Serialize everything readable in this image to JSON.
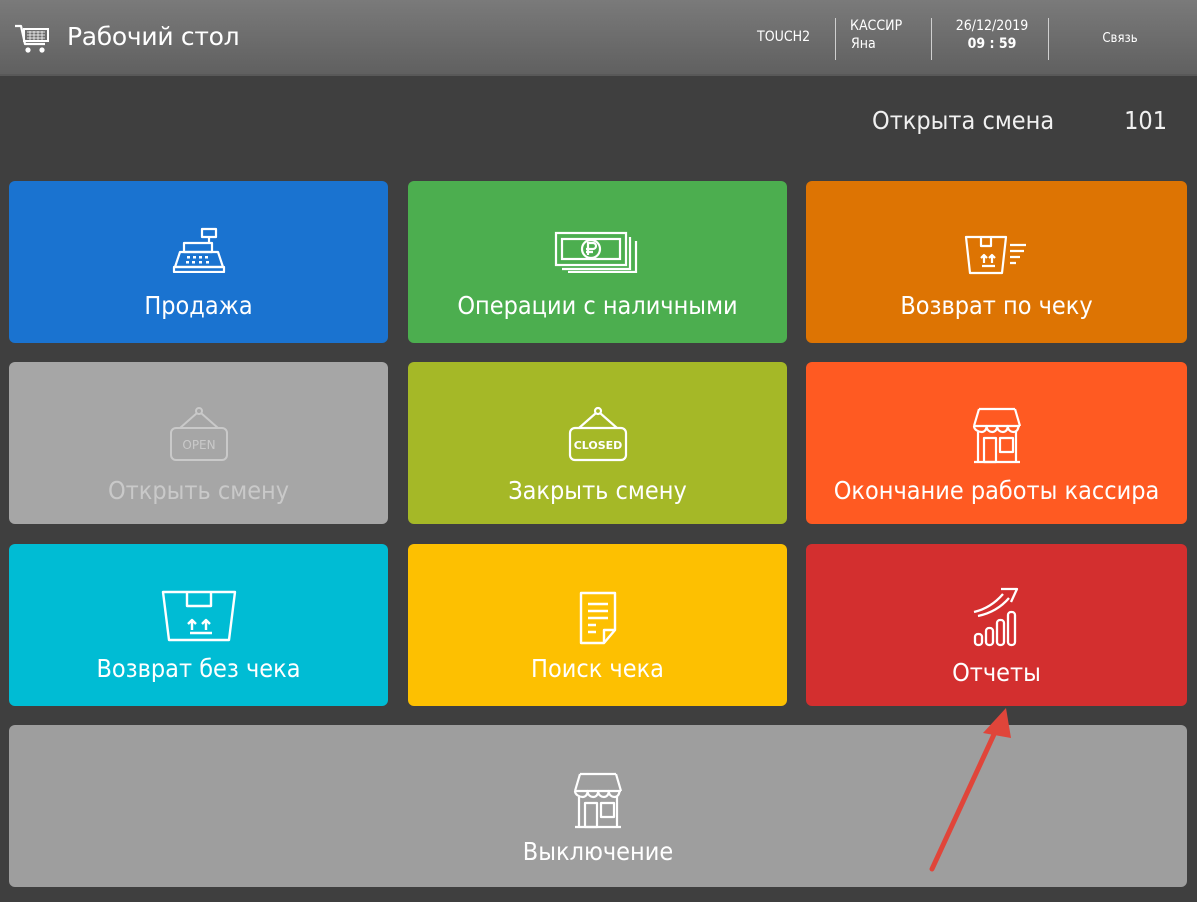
{
  "header": {
    "title": "Рабочий стол",
    "title_icon": "cart-icon",
    "terminal": "TOUCH2",
    "cashier_role": "КАССИР",
    "cashier_name": "Яна",
    "date": "26/12/2019",
    "time": "09 : 59",
    "connection_label": "Связь"
  },
  "shift": {
    "status_label": "Открыта смена",
    "number": "101"
  },
  "tiles": [
    {
      "label": "Продажа",
      "icon": "cash-register-icon",
      "color": "#1a73d0",
      "enabled": true
    },
    {
      "label": "Операции с наличными",
      "icon": "cash-ruble-icon",
      "color": "#4cae4f",
      "enabled": true
    },
    {
      "label": "Возврат по чеку",
      "icon": "return-box-receipt-icon",
      "color": "#dd7403",
      "enabled": true
    },
    {
      "label": "Открыть смену",
      "icon": "open-sign-icon",
      "color": "#a6a6a6",
      "enabled": false
    },
    {
      "label": "Закрыть смену",
      "icon": "closed-sign-icon",
      "color": "#a5b827",
      "enabled": true
    },
    {
      "label": "Окончание работы кассира",
      "icon": "store-icon",
      "color": "#ff5a22",
      "enabled": true
    },
    {
      "label": "Возврат без чека",
      "icon": "return-box-icon",
      "color": "#00bcd4",
      "enabled": true
    },
    {
      "label": "Поиск чека",
      "icon": "receipt-icon",
      "color": "#fdc001",
      "enabled": true
    },
    {
      "label": "Отчеты",
      "icon": "growth-chart-icon",
      "color": "#d32f2f",
      "enabled": true
    },
    {
      "label": "Выключение",
      "icon": "store-icon",
      "color": "#9e9e9e",
      "enabled": true
    }
  ],
  "annotation": {
    "color": "#e0453a"
  }
}
